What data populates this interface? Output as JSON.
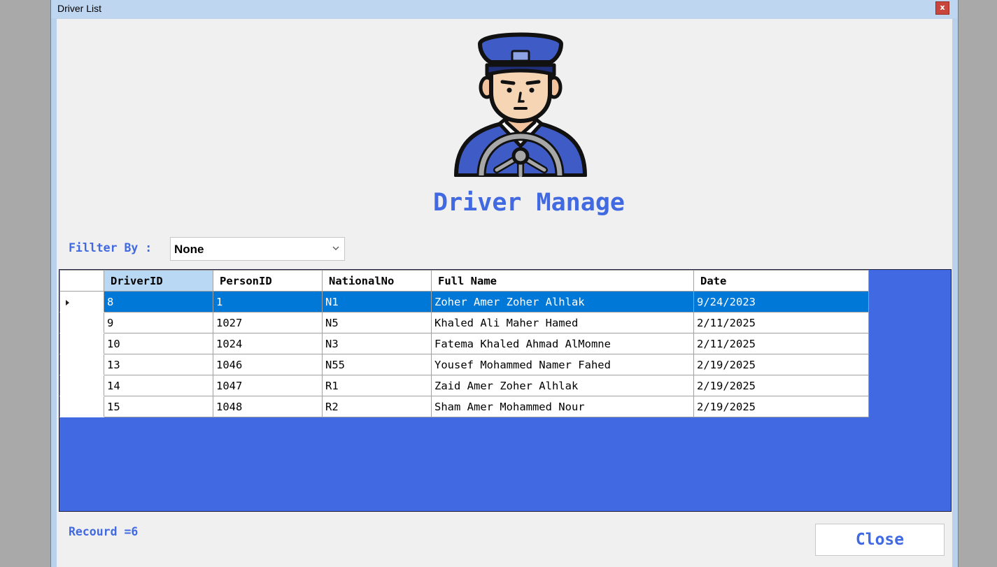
{
  "window": {
    "title": "Driver List",
    "close_glyph": "x"
  },
  "header": {
    "logo_icon": "driver-avatar-icon",
    "title": "Driver Manage"
  },
  "filter": {
    "label": "Fillter By :",
    "selected": "None"
  },
  "grid": {
    "columns": [
      "DriverID",
      "PersonID",
      "NationalNo",
      "Full Name",
      "Date"
    ],
    "selected_row_index": 0,
    "rows": [
      [
        "8",
        "1",
        "N1",
        "Zoher Amer Zoher Alhlak",
        "9/24/2023"
      ],
      [
        "9",
        "1027",
        "N5",
        "Khaled Ali Maher Hamed",
        "2/11/2025"
      ],
      [
        "10",
        "1024",
        "N3",
        "Fatema Khaled Ahmad AlMomne",
        "2/11/2025"
      ],
      [
        "13",
        "1046",
        "N55",
        "Yousef Mohammed Namer Fahed",
        "2/19/2025"
      ],
      [
        "14",
        "1047",
        "R1",
        "Zaid Amer Zoher Alhlak",
        "2/19/2025"
      ],
      [
        "15",
        "1048",
        "R2",
        "Sham Amer Mohammed Nour",
        "2/19/2025"
      ]
    ]
  },
  "footer": {
    "record_count": "Recourd =6",
    "close_label": "Close"
  },
  "colors": {
    "accent": "#4169e1",
    "selection": "#0078d7",
    "grid_background": "#4169e1"
  }
}
